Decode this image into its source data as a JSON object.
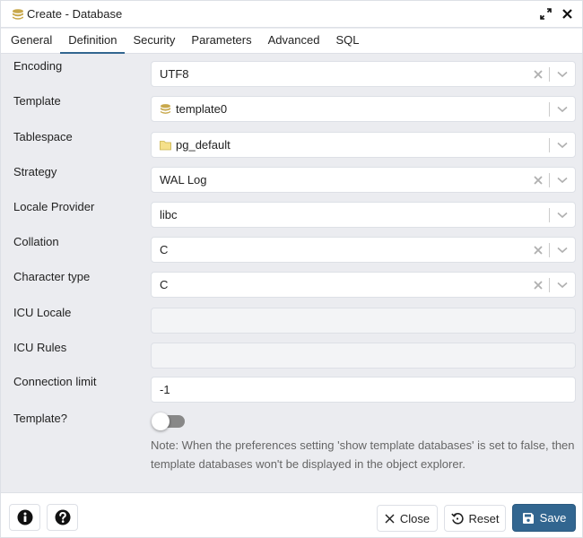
{
  "window": {
    "title": "Create - Database",
    "maximize_icon": "expand-icon",
    "close_icon": "close-icon"
  },
  "tabs": [
    {
      "label": "General",
      "active": false
    },
    {
      "label": "Definition",
      "active": true
    },
    {
      "label": "Security",
      "active": false
    },
    {
      "label": "Parameters",
      "active": false
    },
    {
      "label": "Advanced",
      "active": false
    },
    {
      "label": "SQL",
      "active": false
    }
  ],
  "form": {
    "encoding": {
      "label": "Encoding",
      "value": "UTF8",
      "clearable": true
    },
    "template": {
      "label": "Template",
      "value": "template0",
      "icon": "database-icon",
      "clearable": false
    },
    "tablespace": {
      "label": "Tablespace",
      "value": "pg_default",
      "icon": "folder-icon",
      "clearable": false
    },
    "strategy": {
      "label": "Strategy",
      "value": "WAL Log",
      "clearable": true
    },
    "locale_provider": {
      "label": "Locale Provider",
      "value": "libc",
      "clearable": false
    },
    "collation": {
      "label": "Collation",
      "value": "C",
      "clearable": true
    },
    "character_type": {
      "label": "Character type",
      "value": "C",
      "clearable": true
    },
    "icu_locale": {
      "label": "ICU Locale",
      "value": "",
      "disabled": true
    },
    "icu_rules": {
      "label": "ICU Rules",
      "value": "",
      "disabled": true
    },
    "connection_limit": {
      "label": "Connection limit",
      "value": "-1"
    },
    "is_template": {
      "label": "Template?",
      "checked": false
    },
    "note": "Note: When the preferences setting 'show template databases' is set to false, then template databases won't be displayed in the object explorer."
  },
  "footer": {
    "info_icon": "info-icon",
    "help_icon": "help-icon",
    "close_label": "Close",
    "reset_label": "Reset",
    "save_label": "Save"
  },
  "colors": {
    "accent": "#326690",
    "background": "#ebecf0",
    "db_icon": "#c8a84b",
    "folder_icon": "#f5e08a"
  }
}
